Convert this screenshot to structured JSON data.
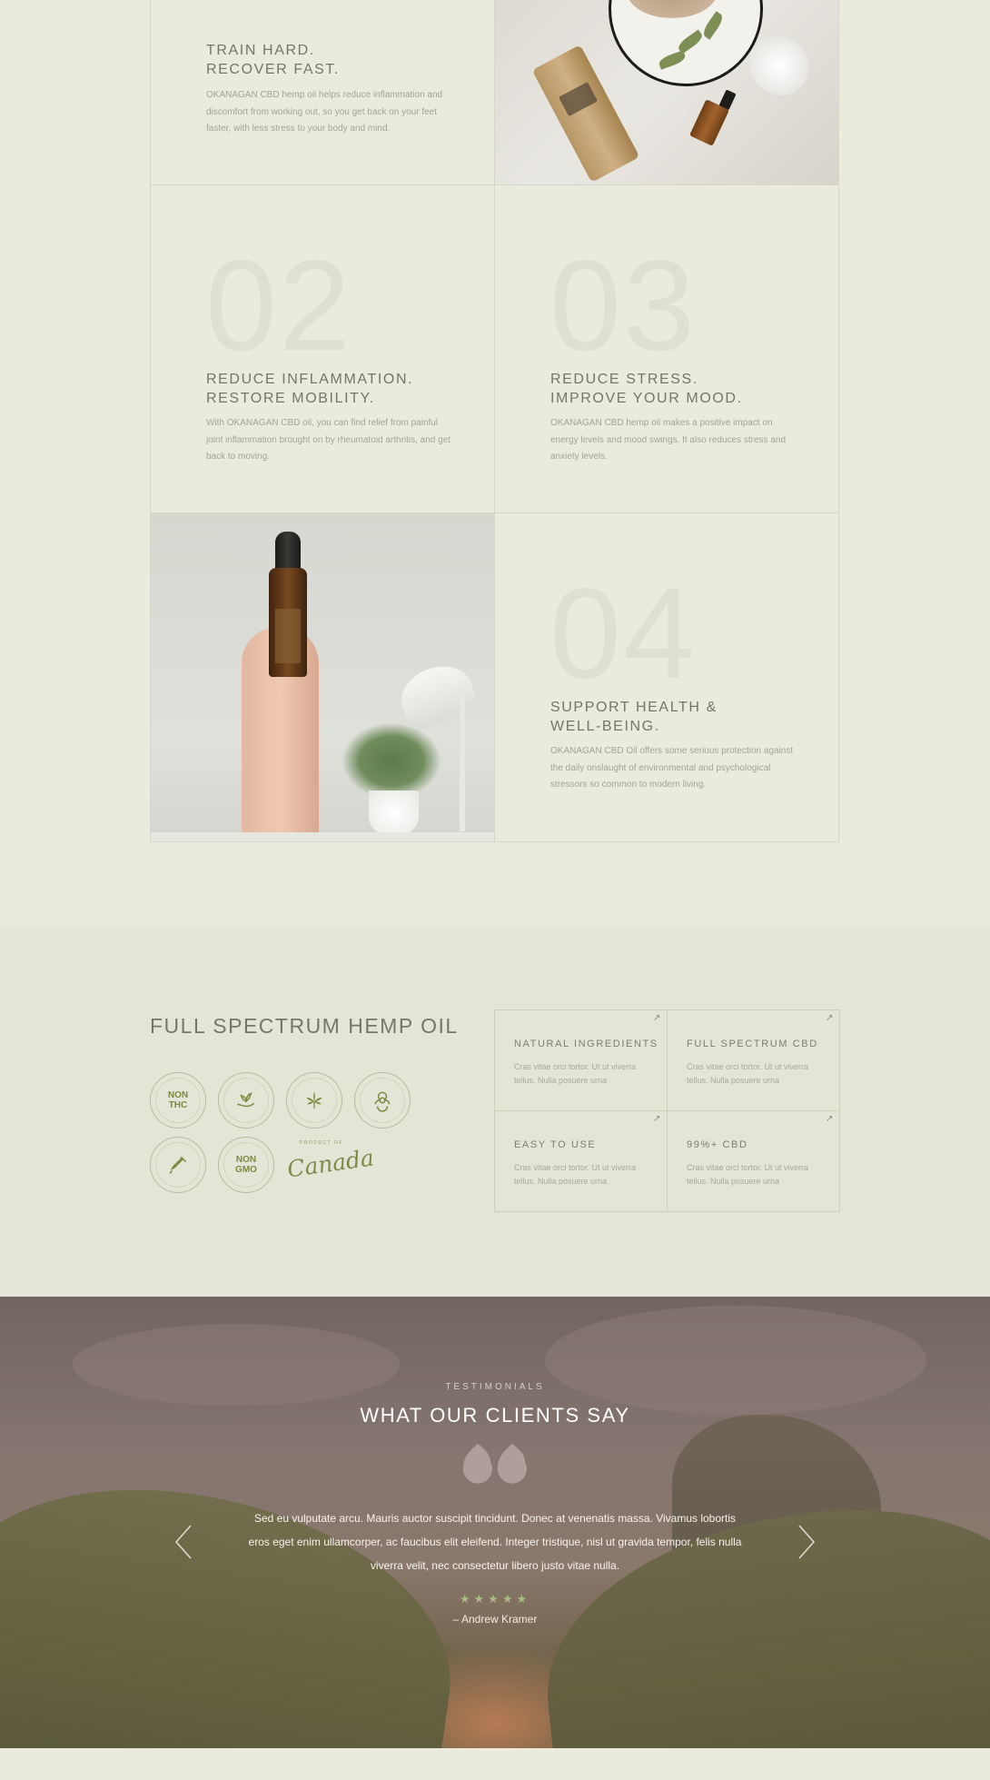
{
  "features": [
    {
      "title": "TRAIN HARD.\nRECOVER FAST.",
      "desc": "OKANAGAN CBD hemp oil helps reduce inflammation and discomfort from working out, so you get back on your feet faster, with less stress to your body and mind."
    },
    {
      "number": "02",
      "title": "REDUCE INFLAMMATION.\nRESTORE MOBILITY.",
      "desc": "With OKANAGAN CBD oil, you can find relief from painful joint inflammation brought on by rheumatoid arthritis, and get back to moving."
    },
    {
      "number": "03",
      "title": "REDUCE STRESS.\nIMPROVE YOUR MOOD.",
      "desc": "OKANAGAN CBD hemp oil makes a positive impact on energy levels and mood swings. It also reduces stress and anxiety levels."
    },
    {
      "number": "04",
      "title": "SUPPORT HEALTH &\nWELL-BEING.",
      "desc": "OKANAGAN CBD Oil offers some serious protection against the daily onslaught of environmental and psychological stressors so common to modern living."
    }
  ],
  "spectrum": {
    "title": "FULL SPECTRUM HEMP OIL",
    "badges": [
      {
        "name": "non-thc-badge",
        "label": "NON\nTHC",
        "icon": "none"
      },
      {
        "name": "vegan-badge",
        "label": "",
        "icon": "hand-leaf-icon"
      },
      {
        "name": "organic-hemp-badge",
        "label": "",
        "icon": "hemp-leaf-icon"
      },
      {
        "name": "non-toxic-badge",
        "label": "",
        "icon": "biohazard-icon"
      },
      {
        "name": "no-artificial-ingredients-badge",
        "label": "",
        "icon": "dropper-icon"
      },
      {
        "name": "non-gmo-badge",
        "label": "NON\nGMO",
        "icon": "none"
      }
    ],
    "canada": "Canada",
    "canada_arc": "PRODUCT OF",
    "items": [
      {
        "title": "NATURAL INGREDIENTS",
        "desc": "Cras vitae orci tortor. Ut ut viverra tellus. Nulla posuere urna"
      },
      {
        "title": "FULL SPECTRUM CBD",
        "desc": "Cras vitae orci tortor. Ut ut viverra tellus. Nulla posuere urna"
      },
      {
        "title": "EASY TO USE",
        "desc": "Cras vitae orci tortor. Ut ut viverra tellus. Nulla posuere urna"
      },
      {
        "title": "99%+ CBD",
        "desc": "Cras vitae orci tortor. Ut ut viverra tellus. Nulla posuere urna"
      }
    ],
    "arrow_icon": "arrow-up-right-icon"
  },
  "testimonials": {
    "kicker": "TESTIMONIALS",
    "title": "WHAT OUR CLIENTS SAY",
    "quote": "Sed eu vulputate arcu. Mauris auctor suscipit tincidunt. Donec at venenatis massa. Vivamus lobortis eros eget enim ullamcorper, ac faucibus elit eleifend. Integer tristique, nisl ut gravida tempor, felis nulla viverra velit, nec consectetur libero justo vitae nulla.",
    "stars": "★★★★★",
    "rating": 5,
    "author": "– Andrew Kramer",
    "star_color": "#a8bb82"
  },
  "colors": {
    "background": "#eaebdd",
    "section_bg": "#e3e5d7",
    "accent_green": "#7b8b3f"
  }
}
